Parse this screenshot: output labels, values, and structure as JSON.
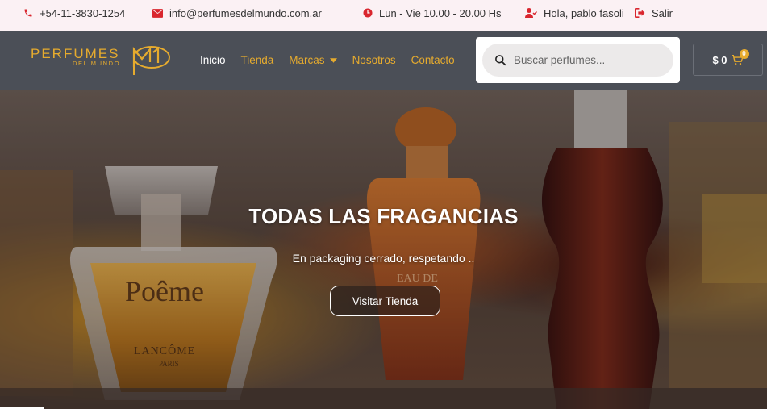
{
  "topbar": {
    "phone": "+54-11-3830-1254",
    "email": "info@perfumesdelmundo.com.ar",
    "hours": "Lun - Vie 10.00 - 20.00 Hs",
    "greeting": "Hola, pablo fasoli",
    "logout": "Salir",
    "icon_color": "#d9262e"
  },
  "header": {
    "logo_word": "PERFUMES",
    "logo_sub": "DEL MUNDO",
    "nav": [
      {
        "label": "Inicio",
        "active": true
      },
      {
        "label": "Tienda"
      },
      {
        "label": "Marcas",
        "has_dropdown": true
      },
      {
        "label": "Nosotros"
      },
      {
        "label": "Contacto"
      }
    ],
    "search_placeholder": "Buscar perfumes...",
    "cart_total": "$ 0",
    "cart_count": "0",
    "brand_color": "#e6ab2e",
    "bg_color": "#4b4f57"
  },
  "hero": {
    "title": "TODAS LAS FRAGANCIAS",
    "subtitle": "En packaging cerrado, respetando ..",
    "button": "Visitar Tienda",
    "bottle_label": "Poême",
    "bottle_brand": "LANCÔME",
    "bottle_city": "PARIS",
    "center_bottle_label": "EAU DE"
  }
}
